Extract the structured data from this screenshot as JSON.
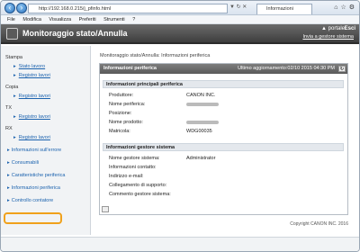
{
  "browser": {
    "url": "http://192.168.0.215/j_pfinfo.html",
    "tab_title": "Informazioni periferica",
    "menu": [
      "File",
      "Modifica",
      "Visualizza",
      "Preferiti",
      "Strumenti",
      "?"
    ]
  },
  "header": {
    "title": "Monitoraggio stato/Annulla",
    "portal_link": "▲ portale",
    "exit_link": "Esci",
    "mail_link": "Invia a gestore sistema"
  },
  "sidebar": {
    "sections": [
      {
        "label": "Stampa",
        "items": [
          "Stato lavoro",
          "Registro lavori"
        ]
      },
      {
        "label": "Copia",
        "items": [
          "Registro lavori"
        ]
      },
      {
        "label": "TX",
        "items": [
          "Registro lavori"
        ]
      },
      {
        "label": "RX",
        "items": [
          "Registro lavori"
        ]
      }
    ],
    "links": [
      "Informazioni sull'errore",
      "Consumabili",
      "Caratteristiche periferica",
      "Informazioni periferica",
      "Controllo contatore"
    ]
  },
  "breadcrumb": "Monitoraggio stato/Annulla: Informazioni periferica",
  "panel": {
    "title": "Informazioni periferica",
    "updated": "Ultimo aggiornamento:02/10 2015 04:30 PM",
    "refresh_icon": "refresh-icon",
    "group1": {
      "title": "Informazioni principali periferica",
      "rows": [
        {
          "label": "Produttore:",
          "value": "CANON INC."
        },
        {
          "label": "Nome periferica:",
          "value": ""
        },
        {
          "label": "Posizione:",
          "value": ""
        },
        {
          "label": "Nome prodotto:",
          "value": ""
        },
        {
          "label": "Matricola:",
          "value": "WDG00035"
        }
      ]
    },
    "group2": {
      "title": "Informazioni gestore sistema",
      "rows": [
        {
          "label": "Nome gestore sistema:",
          "value": "Administrator"
        },
        {
          "label": "Informazioni contatto:",
          "value": ""
        },
        {
          "label": "Indirizzo e-mail:",
          "value": ""
        },
        {
          "label": "Collegamento di supporto:",
          "value": ""
        },
        {
          "label": "Commento gestore sistema:",
          "value": ""
        }
      ]
    }
  },
  "footer": "Copyright CANON INC. 2016",
  "colors": {
    "accent": "#1b62ae",
    "header": "#4a4a4a",
    "highlight": "#f0a11b"
  }
}
